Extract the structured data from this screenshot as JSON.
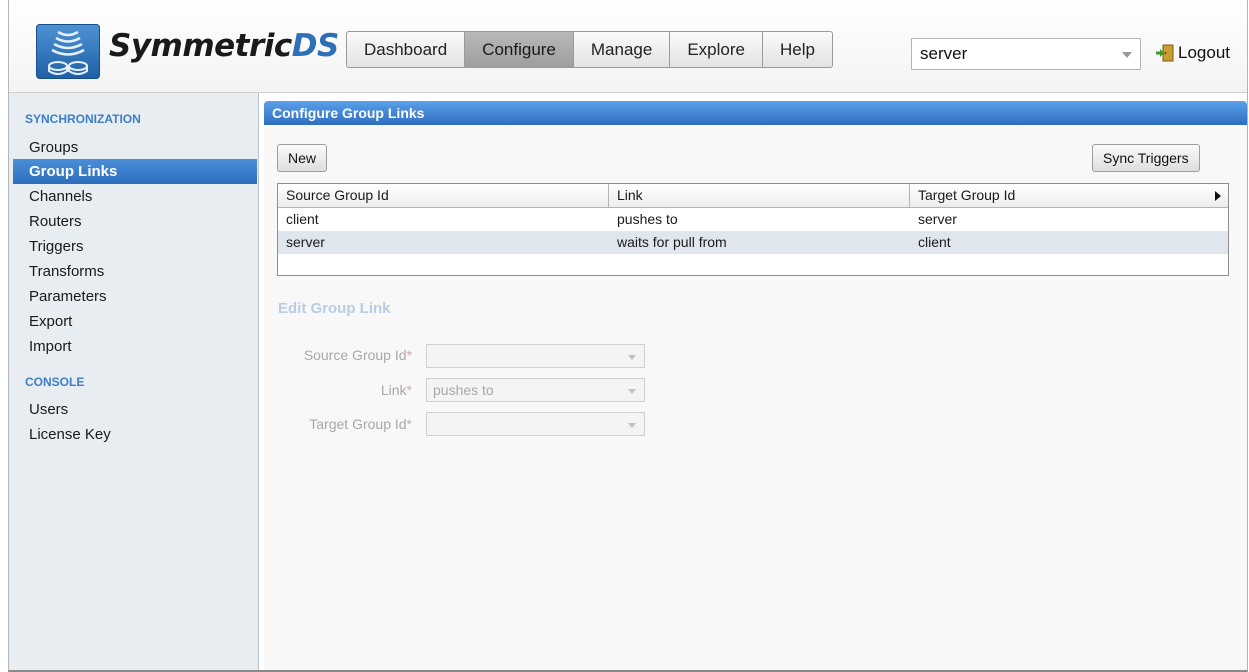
{
  "app": {
    "name_main": "Symmetric",
    "name_accent": "DS"
  },
  "nav": {
    "tabs": [
      "Dashboard",
      "Configure",
      "Manage",
      "Explore",
      "Help"
    ],
    "active": "Configure"
  },
  "node_select": {
    "value": "server"
  },
  "logout_label": "Logout",
  "sidebar": {
    "sections": [
      {
        "title": "SYNCHRONIZATION",
        "items": [
          "Groups",
          "Group Links",
          "Channels",
          "Routers",
          "Triggers",
          "Transforms",
          "Parameters",
          "Export",
          "Import"
        ]
      },
      {
        "title": "CONSOLE",
        "items": [
          "Users",
          "License Key"
        ]
      }
    ],
    "active_item": "Group Links"
  },
  "panel": {
    "title": "Configure Group Links",
    "new_button": "New",
    "sync_button": "Sync Triggers",
    "table": {
      "columns": [
        "Source Group Id",
        "Link",
        "Target Group Id"
      ],
      "rows": [
        [
          "client",
          "pushes to",
          "server"
        ],
        [
          "server",
          "waits for pull from",
          "client"
        ]
      ]
    }
  },
  "form": {
    "title": "Edit Group Link",
    "fields": [
      {
        "label": "Source Group Id",
        "required_mark": "*",
        "value": ""
      },
      {
        "label": "Link",
        "required_mark": "*",
        "value": "pushes to"
      },
      {
        "label": "Target Group Id",
        "required_mark": "*",
        "value": ""
      }
    ]
  },
  "colors": {
    "accent": "#2f6fb7",
    "active_tab": "#a8a8a8",
    "sidebar_bg": "#e8edf2",
    "panel_header": "#3f84d3"
  }
}
